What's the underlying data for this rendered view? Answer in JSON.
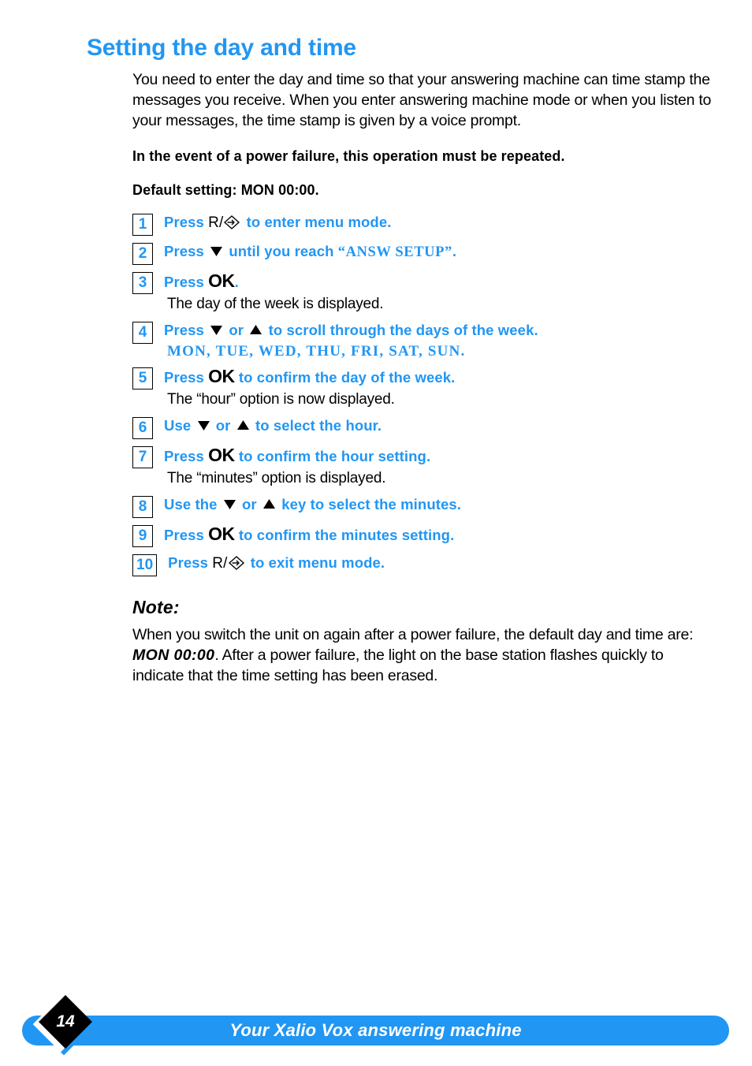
{
  "page": {
    "heading": "Setting the day and time",
    "number": "14",
    "footer_title": "Your Xalio Vox answering machine"
  },
  "intro": {
    "paragraph": "You need to enter the day and time so that your answering machine can time stamp the messages you receive.  When you enter answering machine mode or when you listen to your messages, the time stamp is given by a voice prompt.",
    "power_failure_note": "In the event of a power failure, this operation must be repeated.",
    "default_setting": "Default setting: MON 00:00."
  },
  "steps": [
    {
      "number": "1",
      "press_word": "Press",
      "key_r": "R/",
      "key_icon": "recall-diamond-arrow-icon",
      "text_after": "to enter menu mode."
    },
    {
      "number": "2",
      "press_word": "Press",
      "key_icon": "triangle-down-icon",
      "text_after": "until you reach",
      "quoted_term": "“ANSW SETUP”",
      "trailing": "."
    },
    {
      "number": "3",
      "press_word": "Press",
      "key_ok": "OK",
      "trailing": ".",
      "sub_line": "The day of the week is displayed."
    },
    {
      "number": "4",
      "press_word": "Press",
      "key_icon": "triangle-down-icon",
      "or_word": "or",
      "key_icon2": "triangle-up-icon",
      "text_after": "to scroll through the days of the week.",
      "days_line": "MON, TUE, WED, THU, FRI, SAT, SUN."
    },
    {
      "number": "5",
      "press_word": "Press",
      "key_ok": "OK",
      "text_after": "to confirm the day of the week.",
      "sub_line": "The “hour” option is now displayed."
    },
    {
      "number": "6",
      "press_word": "Use",
      "key_icon": "triangle-down-icon",
      "or_word": "or",
      "key_icon2": "triangle-up-icon",
      "text_after": "to select the hour."
    },
    {
      "number": "7",
      "press_word": "Press",
      "key_ok": "OK",
      "text_after": "to confirm the hour setting.",
      "sub_line": "The  “minutes” option is displayed."
    },
    {
      "number": "8",
      "press_word": "Use the",
      "key_icon": "triangle-down-icon",
      "or_word": "or",
      "key_icon2": "triangle-up-icon",
      "text_after": "key to select the minutes."
    },
    {
      "number": "9",
      "press_word": "Press",
      "key_ok": "OK",
      "text_after": "to confirm the minutes setting."
    },
    {
      "number": "10",
      "press_word": "Press",
      "key_r": "R/",
      "key_icon": "recall-diamond-arrow-icon",
      "text_after": "to exit menu mode."
    }
  ],
  "note": {
    "heading": "Note:",
    "text_before": "When you switch the unit on again after a power failure, the default day and time are:",
    "emphasis": "MON  00:00",
    "text_after": ".  After a power failure, the light on the base station flashes quickly to indicate that the time setting has been erased."
  },
  "colors": {
    "accent_blue": "#2196f3",
    "text_black": "#000000",
    "page_background": "#ffffff"
  }
}
